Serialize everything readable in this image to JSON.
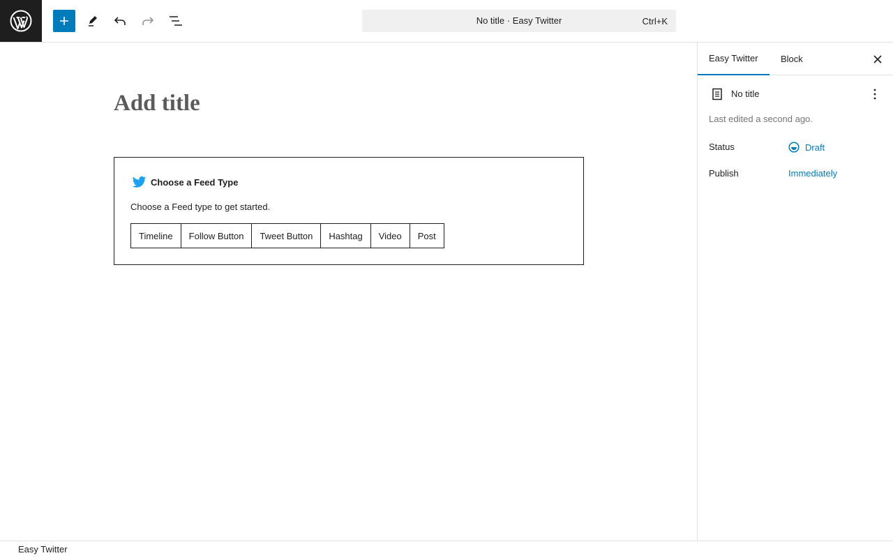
{
  "toolbar": {
    "logo_icon": "wordpress-logo-icon",
    "add_icon": "plus-icon",
    "tools_icon": "pencil-icon",
    "undo_icon": "undo-icon",
    "redo_icon": "redo-icon",
    "outline_icon": "list-view-icon",
    "accent_color": "#007cba"
  },
  "command": {
    "title": "No title · Easy Twitter",
    "shortcut": "Ctrl+K"
  },
  "editor": {
    "title_placeholder": "Add title",
    "feed_block": {
      "icon": "twitter-bird-icon",
      "heading": "Choose a Feed Type",
      "description": "Choose a Feed type to get started.",
      "buttons": [
        "Timeline",
        "Follow Button",
        "Tweet Button",
        "Hashtag",
        "Video",
        "Post"
      ],
      "bird_color": "#1da1f2"
    }
  },
  "sidebar": {
    "tabs": [
      "Easy Twitter",
      "Block"
    ],
    "active_tab": "Easy Twitter",
    "close_icon": "close-icon",
    "document": {
      "icon": "document-icon",
      "title": "No title",
      "more_icon": "more-vertical-icon"
    },
    "last_edited": "Last edited a second ago.",
    "status_label": "Status",
    "status_value": "Draft",
    "status_icon": "draft-status-icon",
    "publish_label": "Publish",
    "publish_value": "Immediately"
  },
  "footer": {
    "breadcrumb": "Easy Twitter"
  }
}
